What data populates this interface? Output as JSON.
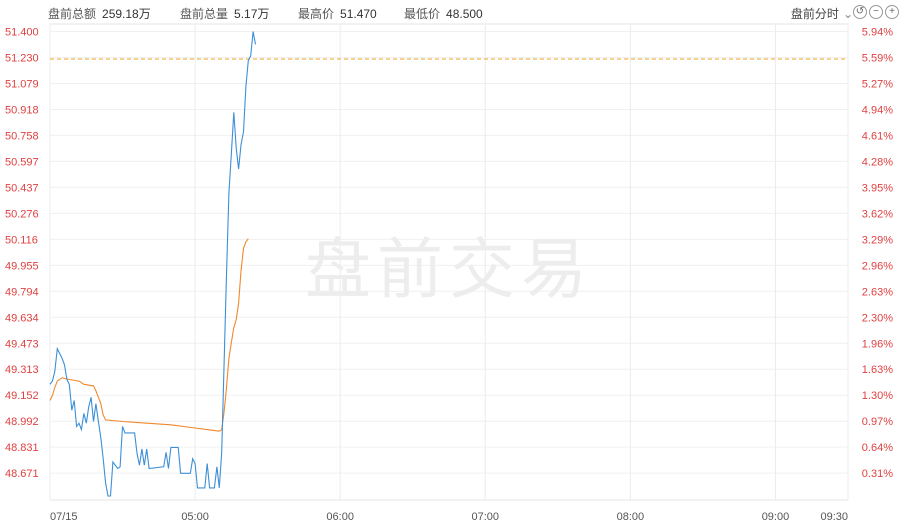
{
  "header": {
    "stats": [
      {
        "label": "盘前总额",
        "value": "259.18万"
      },
      {
        "label": "盘前总量",
        "value": "5.17万"
      },
      {
        "label": "最高价",
        "value": "51.470"
      },
      {
        "label": "最低价",
        "value": "48.500"
      }
    ],
    "mode_label": "盘前分时"
  },
  "colors": {
    "price_line": "#3d8fd6",
    "avg_line": "#f0882b",
    "ref_line": "#f0a020",
    "axis_text": "#e04040"
  },
  "chart_data": {
    "type": "line",
    "watermark": "盘前交易",
    "reference_price": "51.230",
    "reference_pct": "5.59%",
    "y_left_ticks": [
      "51.400",
      "51.230",
      "51.079",
      "50.918",
      "50.758",
      "50.597",
      "50.437",
      "50.276",
      "50.116",
      "49.955",
      "49.794",
      "49.634",
      "49.473",
      "49.313",
      "49.152",
      "48.992",
      "48.831",
      "48.671"
    ],
    "y_right_ticks": [
      "5.94%",
      "5.59%",
      "5.27%",
      "4.94%",
      "4.61%",
      "4.28%",
      "3.95%",
      "3.62%",
      "3.29%",
      "2.96%",
      "2.63%",
      "2.30%",
      "1.96%",
      "1.63%",
      "1.30%",
      "0.97%",
      "0.64%",
      "0.31%"
    ],
    "x_ticks": [
      "07/15",
      "05:00",
      "06:00",
      "07:00",
      "08:00",
      "09:00",
      "09:30"
    ],
    "ylim": [
      48.51,
      51.4
    ],
    "x_range": [
      "04:00",
      "09:30"
    ],
    "series": [
      {
        "key": "price",
        "points": [
          [
            "04:00",
            49.22
          ],
          [
            "04:01",
            49.24
          ],
          [
            "04:02",
            49.3
          ],
          [
            "04:03",
            49.44
          ],
          [
            "04:05",
            49.38
          ],
          [
            "04:06",
            49.34
          ],
          [
            "04:07",
            49.25
          ],
          [
            "04:08",
            49.22
          ],
          [
            "04:09",
            49.06
          ],
          [
            "04:10",
            49.12
          ],
          [
            "04:11",
            48.96
          ],
          [
            "04:12",
            48.98
          ],
          [
            "04:13",
            48.94
          ],
          [
            "04:14",
            49.04
          ],
          [
            "04:15",
            48.98
          ],
          [
            "04:16",
            49.08
          ],
          [
            "04:17",
            49.14
          ],
          [
            "04:18",
            48.99
          ],
          [
            "04:19",
            49.1
          ],
          [
            "04:20",
            48.99
          ],
          [
            "04:21",
            48.89
          ],
          [
            "04:22",
            48.76
          ],
          [
            "04:23",
            48.61
          ],
          [
            "04:24",
            48.53
          ],
          [
            "04:25",
            48.53
          ],
          [
            "04:26",
            48.74
          ],
          [
            "04:28",
            48.7
          ],
          [
            "04:29",
            48.71
          ],
          [
            "04:30",
            48.96
          ],
          [
            "04:31",
            48.92
          ],
          [
            "04:35",
            48.92
          ],
          [
            "04:36",
            48.79
          ],
          [
            "04:37",
            48.72
          ],
          [
            "04:38",
            48.82
          ],
          [
            "04:39",
            48.72
          ],
          [
            "04:40",
            48.82
          ],
          [
            "04:41",
            48.7
          ],
          [
            "04:47",
            48.71
          ],
          [
            "04:48",
            48.8
          ],
          [
            "04:49",
            48.7
          ],
          [
            "04:50",
            48.83
          ],
          [
            "04:53",
            48.83
          ],
          [
            "04:54",
            48.67
          ],
          [
            "04:58",
            48.67
          ],
          [
            "04:59",
            48.76
          ],
          [
            "05:00",
            48.73
          ],
          [
            "05:01",
            48.58
          ],
          [
            "05:04",
            48.58
          ],
          [
            "05:05",
            48.73
          ],
          [
            "05:06",
            48.58
          ],
          [
            "05:08",
            48.58
          ],
          [
            "05:09",
            48.71
          ],
          [
            "05:10",
            48.58
          ],
          [
            "05:11",
            48.8
          ],
          [
            "05:12",
            49.35
          ],
          [
            "05:13",
            49.9
          ],
          [
            "05:14",
            50.4
          ],
          [
            "05:15",
            50.65
          ],
          [
            "05:16",
            50.9
          ],
          [
            "05:17",
            50.68
          ],
          [
            "05:18",
            50.55
          ],
          [
            "05:19",
            50.7
          ],
          [
            "05:20",
            50.78
          ],
          [
            "05:21",
            51.06
          ],
          [
            "05:22",
            51.22
          ],
          [
            "05:23",
            51.25
          ],
          [
            "05:24",
            51.4
          ],
          [
            "05:25",
            51.32
          ]
        ]
      },
      {
        "key": "average",
        "points": [
          [
            "04:00",
            49.12
          ],
          [
            "04:01",
            49.15
          ],
          [
            "04:02",
            49.2
          ],
          [
            "04:03",
            49.24
          ],
          [
            "04:05",
            49.26
          ],
          [
            "04:08",
            49.25
          ],
          [
            "04:12",
            49.24
          ],
          [
            "04:14",
            49.22
          ],
          [
            "04:18",
            49.21
          ],
          [
            "04:19",
            49.18
          ],
          [
            "04:20",
            49.14
          ],
          [
            "04:21",
            49.1
          ],
          [
            "04:22",
            49.03
          ],
          [
            "04:23",
            49.0
          ],
          [
            "04:30",
            48.99
          ],
          [
            "04:50",
            48.97
          ],
          [
            "05:00",
            48.95
          ],
          [
            "05:05",
            48.94
          ],
          [
            "05:10",
            48.93
          ],
          [
            "05:11",
            48.94
          ],
          [
            "05:12",
            49.05
          ],
          [
            "05:13",
            49.2
          ],
          [
            "05:14",
            49.38
          ],
          [
            "05:15",
            49.48
          ],
          [
            "05:16",
            49.57
          ],
          [
            "05:17",
            49.62
          ],
          [
            "05:18",
            49.72
          ],
          [
            "05:19",
            49.92
          ],
          [
            "05:20",
            50.06
          ],
          [
            "05:21",
            50.1
          ],
          [
            "05:22",
            50.12
          ]
        ]
      }
    ]
  }
}
